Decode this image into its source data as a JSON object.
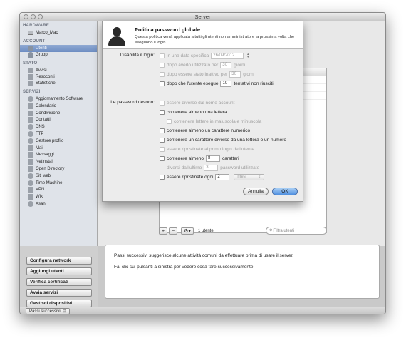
{
  "window": {
    "title": "Server"
  },
  "sidebar": {
    "sections": [
      {
        "header": "HARDWARE",
        "items": [
          {
            "label": "Marco_Mac",
            "icon": "computer-icon"
          }
        ]
      },
      {
        "header": "ACCOUNT",
        "items": [
          {
            "label": "Utenti",
            "icon": "user-icon",
            "selected": true
          },
          {
            "label": "Gruppi",
            "icon": "group-icon"
          }
        ]
      },
      {
        "header": "STATO",
        "items": [
          {
            "label": "Avvisi",
            "icon": "alert-icon"
          },
          {
            "label": "Resoconti",
            "icon": "report-icon"
          },
          {
            "label": "Statistiche",
            "icon": "stats-icon"
          }
        ]
      },
      {
        "header": "SERVIZI",
        "items": [
          {
            "label": "Aggiornamento Software",
            "icon": "software-update-icon"
          },
          {
            "label": "Calendario",
            "icon": "calendar-icon"
          },
          {
            "label": "Condivisione",
            "icon": "sharing-icon"
          },
          {
            "label": "Contatti",
            "icon": "contacts-icon"
          },
          {
            "label": "DNS",
            "icon": "dns-icon"
          },
          {
            "label": "FTP",
            "icon": "ftp-icon"
          },
          {
            "label": "Gestore profilo",
            "icon": "profile-manager-icon"
          },
          {
            "label": "Mail",
            "icon": "mail-icon"
          },
          {
            "label": "Messaggi",
            "icon": "messages-icon"
          },
          {
            "label": "NetInstall",
            "icon": "netinstall-icon"
          },
          {
            "label": "Open Directory",
            "icon": "open-directory-icon"
          },
          {
            "label": "Siti web",
            "icon": "websites-icon"
          },
          {
            "label": "Time Machine",
            "icon": "time-machine-icon"
          },
          {
            "label": "VPN",
            "icon": "vpn-icon"
          },
          {
            "label": "Wiki",
            "icon": "wiki-icon"
          },
          {
            "label": "Xsan",
            "icon": "xsan-icon"
          }
        ]
      }
    ]
  },
  "list_footer": {
    "add": "+",
    "remove": "−",
    "gear": "⚙▾",
    "user_count": "1 utente",
    "filter_placeholder": "Filtra utenti"
  },
  "next_steps": {
    "buttons": [
      "Configura network",
      "Aggiungi utenti",
      "Verifica certificati",
      "Avvia servizi",
      "Gestisci dispositivi"
    ],
    "text1": "Passi successivi suggerisce alcune attività comuni da effettuare prima di usare il server.",
    "text2": "Fai clic sui pulsanti a sinistra per vedere cosa fare successivamente.",
    "toggle_label": "Passi successivi"
  },
  "sheet": {
    "title": "Politica password globale",
    "description": "Questa politica verrà applicata a tutti gli utenti non amministratore la prossima volta che eseguono il login.",
    "disable_label": "Disabilita il login:",
    "disable_rows": [
      {
        "pre": "in una data specifica",
        "value": "26/09/2012",
        "post": "",
        "checked": false,
        "disabled": true,
        "stepper": true
      },
      {
        "pre": "dopo averlo utilizzato per",
        "value": "30",
        "post": "giorni",
        "checked": false,
        "disabled": true
      },
      {
        "pre": "dopo essere stato inattivo per",
        "value": "30",
        "post": "giorni",
        "checked": false,
        "disabled": true
      },
      {
        "pre": "dopo che l'utente esegue",
        "value": "10",
        "post": "tentativi non riusciti",
        "checked": false,
        "disabled": false
      }
    ],
    "password_label": "Le password devono:",
    "password_rows": [
      {
        "text": "essere diverse dal nome account",
        "disabled": true
      },
      {
        "text": "contenere almeno una lettera",
        "disabled": false
      },
      {
        "text": "contenere lettere in maiuscola e minuscola",
        "disabled": true,
        "indent": true
      },
      {
        "text": "contenere almeno un carattere numerico",
        "disabled": false
      },
      {
        "text": "contenere un carattere diverso da una lettera o un numero",
        "disabled": false
      },
      {
        "text": "essere ripristinate al primo login dell'utente",
        "disabled": true
      }
    ],
    "min_chars": {
      "pre": "contenere almeno",
      "value": "8",
      "post": "caratteri"
    },
    "differ_last": {
      "pre": "diversi dall'ultimo",
      "value": "3",
      "post": "password utilizzate"
    },
    "reset_every": {
      "pre": "essere ripristinate ogni",
      "value": "2",
      "unit": "mesi"
    },
    "cancel": "Annulla",
    "ok": "OK"
  }
}
